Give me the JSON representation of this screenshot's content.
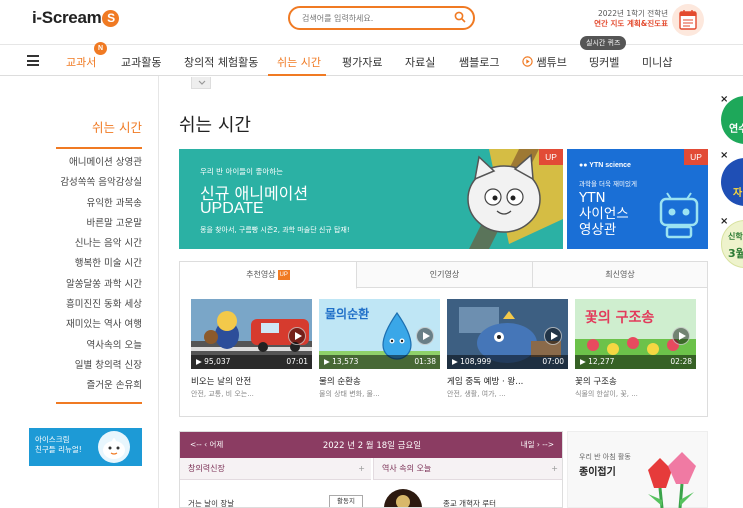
{
  "header": {
    "logo_text": "i-Scream",
    "logo_badge": "S",
    "search_placeholder": "검색어를 입력하세요.",
    "notice_line1": "2022년 1학기 전학년",
    "notice_line2": "연간 지도 계획&진도표"
  },
  "nav": {
    "items": [
      "교과서",
      "교과활동",
      "창의적 체험활동",
      "쉬는 시간",
      "평가자료",
      "자료실",
      "쌤블로그",
      "쌤튜브",
      "띵커벨",
      "미니샵"
    ],
    "active_index": 3,
    "new_badge": "N",
    "tooltip": "실시간 퀴즈"
  },
  "sidebar": {
    "title": "쉬는 시간",
    "items": [
      "애니메이션 상영관",
      "감성쏙쏙 음악감상실",
      "유익한 과목송",
      "바른말 고운말",
      "신나는 음악 시간",
      "행복한 미술 시간",
      "알쏭달쏭 과학 시간",
      "흥미진진 동화 세상",
      "재미있는 역사 여행",
      "역사속의 오늘",
      "일별 창의력 신장",
      "즐거운 손유희"
    ],
    "banner_line1": "아이스크림",
    "banner_line2": "친구들 리뉴얼!"
  },
  "main": {
    "page_title": "쉬는 시간",
    "banner1": {
      "small": "우리 반 아이들이 좋아하는",
      "title1": "신규 애니메이션",
      "title2": "UPDATE",
      "desc": "몽을 찾아서, 구름빵 시즌2, 과학 마술단 신규 탑재!",
      "tag": "UP"
    },
    "banner2": {
      "logo": "YTN science",
      "desc": "과학을 더욱 재미있게",
      "title1": "YTN",
      "title2": "사이언스",
      "title3": "영상관",
      "tag": "UP"
    },
    "tabs": [
      "추천영상",
      "인기영상",
      "최신영상"
    ],
    "tab_badge": "UP",
    "videos": [
      {
        "views": "95,037",
        "duration": "07:01",
        "title": "비오는 날의 안전",
        "sub": "안전, 교통, 비 오는..."
      },
      {
        "views": "13,573",
        "duration": "01:38",
        "title": "물의 순환송",
        "sub": "물의 상태 변화, 물..."
      },
      {
        "views": "108,999",
        "duration": "07:00",
        "title": "게임 중독 예방 · 왕...",
        "sub": "안전, 생활, 여가, ..."
      },
      {
        "views": "12,277",
        "duration": "02:28",
        "title": "꽃의 구조송",
        "sub": "식물의 한살이, 꽃, ..."
      }
    ],
    "thumb_text_2": "물의순환",
    "thumb_text_4": "꽃의 구조송"
  },
  "calendar": {
    "prev": "어제",
    "date": "2022 년 2 월 18일 금요일",
    "next": "내일",
    "col1": "창의력신장",
    "col2": "역사 속의 오늘",
    "row1": "거는 날이 장날",
    "button": "활동지",
    "row2": "종교 개혁자 루터"
  },
  "paper": {
    "small": "우리 반 아침 활동",
    "title": "종이접기"
  },
  "floating": {
    "close": "×",
    "text1": "연수",
    "text2": "자",
    "text3": "신학",
    "text4": "3월"
  },
  "colors": {
    "accent": "#f07a23",
    "teal_banner": "#2bb1a4",
    "ytn_banner": "#1a6fd6",
    "calendar_header": "#8b3c62",
    "up_red": "#e24b36"
  }
}
